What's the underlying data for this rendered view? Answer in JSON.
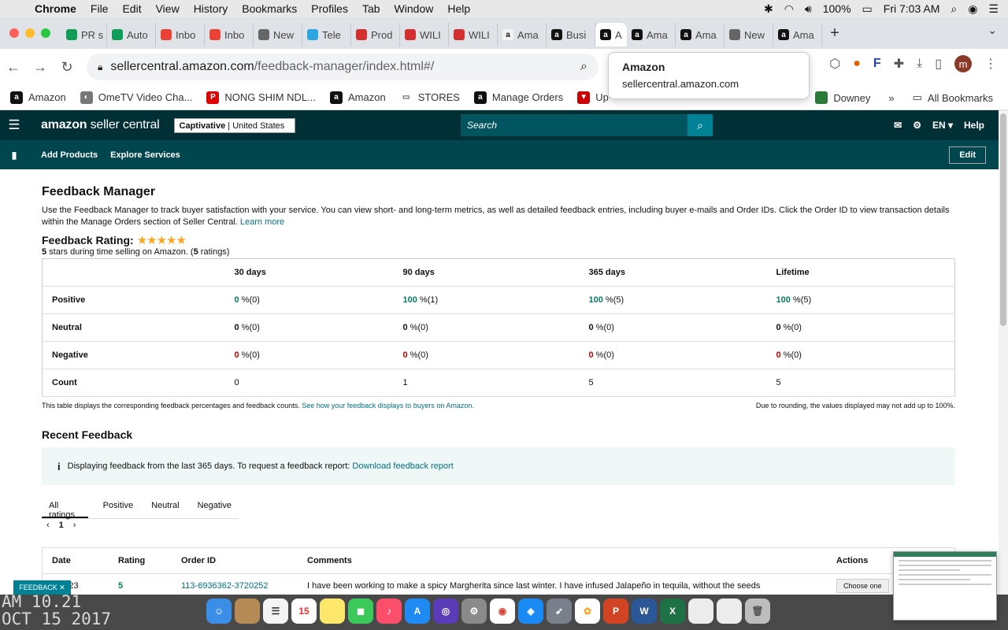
{
  "menubar": {
    "app": "Chrome",
    "items": [
      "File",
      "Edit",
      "View",
      "History",
      "Bookmarks",
      "Profiles",
      "Tab",
      "Window",
      "Help"
    ],
    "battery": "100%",
    "clock": "Fri 7:03 AM"
  },
  "tabs": [
    {
      "label": "PR s",
      "icon": "sheets",
      "color": "#0f9d58"
    },
    {
      "label": "Auto",
      "icon": "sheets",
      "color": "#0f9d58"
    },
    {
      "label": "Inbo",
      "icon": "gmail",
      "color": "#ea4335"
    },
    {
      "label": "Inbo",
      "icon": "gmail",
      "color": "#ea4335"
    },
    {
      "label": "New",
      "icon": "chrome",
      "color": "#666"
    },
    {
      "label": "Tele",
      "icon": "telegram",
      "color": "#2ca5e0"
    },
    {
      "label": "Prod",
      "icon": "pinwheel",
      "color": "#d32f2f"
    },
    {
      "label": "WILI",
      "icon": "pinwheel",
      "color": "#d32f2f"
    },
    {
      "label": "WILI",
      "icon": "pinwheel",
      "color": "#d32f2f"
    },
    {
      "label": "Ama",
      "icon": "amazon-a",
      "color": "#f3f3f3"
    },
    {
      "label": "Busi",
      "icon": "amazon",
      "color": "#111"
    },
    {
      "label": "A",
      "icon": "amazon",
      "color": "#111"
    },
    {
      "label": "Ama",
      "icon": "amazon",
      "color": "#111"
    },
    {
      "label": "Ama",
      "icon": "amazon",
      "color": "#111"
    },
    {
      "label": "New",
      "icon": "chrome",
      "color": "#666"
    },
    {
      "label": "Ama",
      "icon": "amazon",
      "color": "#111"
    }
  ],
  "omnibox": {
    "host": "sellercentral.amazon.com",
    "path": "/feedback-manager/index.html#/"
  },
  "popup": {
    "title": "Amazon",
    "url": "sellercentral.amazon.com"
  },
  "bookmarks": [
    {
      "label": "Amazon",
      "color": "#111",
      "g": "a"
    },
    {
      "label": "OmeTV Video Cha...",
      "color": "#777",
      "g": "◐"
    },
    {
      "label": "NONG SHIM NDL...",
      "color": "#d00",
      "g": "P"
    },
    {
      "label": "Amazon",
      "color": "#111",
      "g": "a"
    },
    {
      "label": "STORES",
      "color": "#fff",
      "g": "▭"
    },
    {
      "label": "Manage Orders",
      "color": "#111",
      "g": "a"
    },
    {
      "label": "Up",
      "color": "#c00",
      "g": "▼"
    }
  ],
  "bookmarks_right": {
    "item": "Downey",
    "all": "All Bookmarks"
  },
  "seller": {
    "logo_a": "amazon",
    "logo_b": "seller central",
    "account": "Captivative",
    "region": "United States",
    "search_placeholder": "Search",
    "lang": "EN",
    "help": "Help",
    "sub": [
      "Add Products",
      "Explore Services"
    ],
    "edit": "Edit"
  },
  "page": {
    "title": "Feedback Manager",
    "desc": "Use the Feedback Manager to track buyer satisfaction with your service. You can view short- and long-term metrics, as well as detailed feedback entries, including buyer e-mails and Order IDs. Click the Order ID to view transaction details within the Manage Orders section of Seller Central.",
    "learn_more": "Learn more",
    "rating_label": "Feedback Rating:",
    "rating_stars": "★★★★★",
    "rating_sub_a": "5",
    "rating_sub_b": " stars during time selling on Amazon. (",
    "rating_sub_c": "5",
    "rating_sub_d": " ratings)"
  },
  "table": {
    "headers": [
      "30 days",
      "90 days",
      "365 days",
      "Lifetime"
    ],
    "positive": {
      "label": "Positive",
      "values": [
        "0",
        "100",
        "100",
        "100"
      ],
      "counts": [
        " %(0)",
        " %(1)",
        " %(5)",
        " %(5)"
      ]
    },
    "neutral": {
      "label": "Neutral",
      "values": [
        "0",
        "0",
        "0",
        "0"
      ],
      "counts": [
        " %(0)",
        " %(0)",
        " %(0)",
        " %(0)"
      ]
    },
    "negative": {
      "label": "Negative",
      "values": [
        "0",
        "0",
        "0",
        "0"
      ],
      "counts": [
        " %(0)",
        " %(0)",
        " %(0)",
        " %(0)"
      ]
    },
    "count": {
      "label": "Count",
      "values": [
        "0",
        "1",
        "5",
        "5"
      ]
    },
    "note": "This table displays the corresponding feedback percentages and feedback counts.",
    "note_link": "See how your feedback displays to buyers on Amazon.",
    "rounding": "Due to rounding, the values displayed may not add up to 100%."
  },
  "recent": {
    "title": "Recent Feedback",
    "info": "Displaying feedback from the last 365 days. To request a feedback report:",
    "info_link": "Download feedback report",
    "tabs": [
      "All ratings",
      "Positive",
      "Neutral",
      "Negative"
    ],
    "page": "1",
    "cols": [
      "Date",
      "Rating",
      "Order ID",
      "Comments",
      "Actions"
    ],
    "row": {
      "date": "8/2023",
      "rating": "5",
      "order": "113-6936362-3720252",
      "comment": "I have been working to make a spicy Margherita since last winter. I have infused Jalapeño in tequila, without the seeds",
      "action": "Choose one"
    }
  },
  "feedback_btn": "FEEDBACK ✕",
  "desktop_date": [
    "AM 10.21",
    "OCT 15 2017"
  ]
}
